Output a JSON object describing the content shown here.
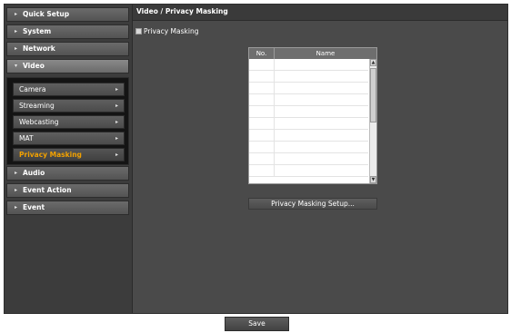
{
  "sidebar": {
    "items": [
      {
        "label": "Quick Setup"
      },
      {
        "label": "System"
      },
      {
        "label": "Network"
      },
      {
        "label": "Video"
      },
      {
        "label": "Audio"
      },
      {
        "label": "Event Action"
      },
      {
        "label": "Event"
      }
    ],
    "video_submenu": [
      {
        "label": "Camera"
      },
      {
        "label": "Streaming"
      },
      {
        "label": "Webcasting"
      },
      {
        "label": "MAT"
      },
      {
        "label": "Privacy Masking",
        "selected": true
      }
    ]
  },
  "header": {
    "title": "Video / Privacy Masking"
  },
  "privacy_masking": {
    "checkbox_label": "Privacy Masking",
    "checked": false
  },
  "mask_table": {
    "columns": [
      "No.",
      "Name"
    ],
    "rows": []
  },
  "setup_button": {
    "label": "Privacy Masking Setup..."
  },
  "save_button": {
    "label": "Save"
  },
  "colors": {
    "accent_selected": "#f2a100",
    "panel_bg": "#4a4a4a"
  }
}
